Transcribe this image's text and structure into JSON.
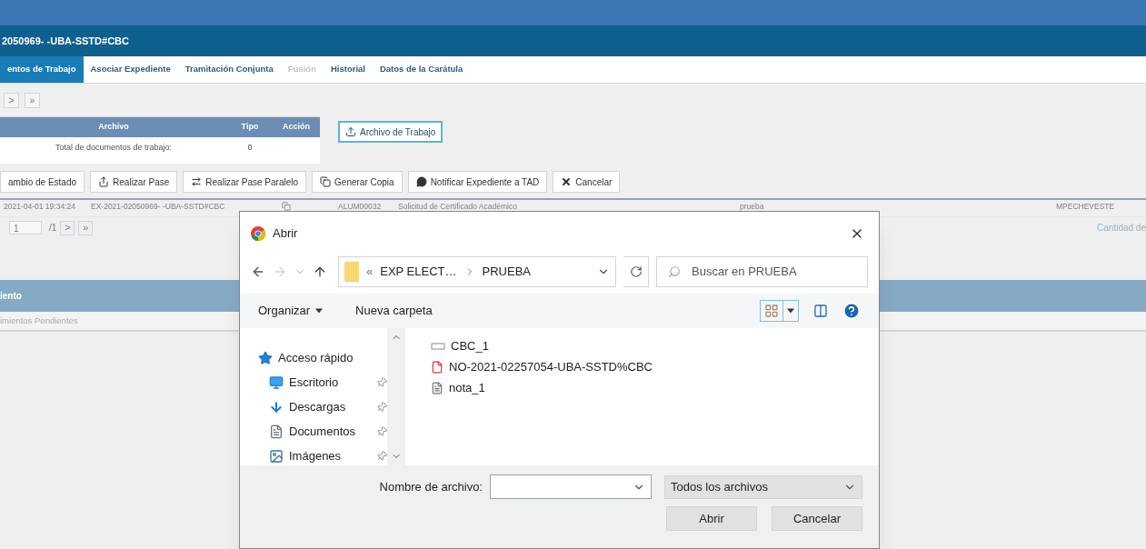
{
  "header": {
    "title": "2050969- -UBA-SSTD#CBC"
  },
  "tabs": [
    {
      "label": "entos de Trabajo",
      "selected": true,
      "disabled": false
    },
    {
      "label": "Asociar Expediente",
      "selected": false,
      "disabled": false
    },
    {
      "label": "Tramitación Conjunta",
      "selected": false,
      "disabled": false
    },
    {
      "label": "Fusión",
      "selected": false,
      "disabled": true
    },
    {
      "label": "Historial",
      "selected": false,
      "disabled": false
    },
    {
      "label": "Datos de la Carátula",
      "selected": false,
      "disabled": false
    }
  ],
  "pager_top": [
    ">",
    "»"
  ],
  "work_table": {
    "columns": [
      "Archivo",
      "Tipo",
      "Acción"
    ],
    "total_label": "Total de documentos de trabajo:",
    "total_value": "0"
  },
  "upload_button": "Archivo de Trabajo",
  "actions": [
    {
      "label": "ambio de Estado",
      "kind": "none"
    },
    {
      "label": "Realizar Pase",
      "kind": "share"
    },
    {
      "label": "Realizar Pase Paralelo",
      "kind": "swap"
    },
    {
      "label": "Generar Copia",
      "kind": "copy"
    },
    {
      "label": "Notificar Expediente a TAD",
      "kind": "comment"
    },
    {
      "label": "Cancelar",
      "kind": "cancel"
    }
  ],
  "record": {
    "date": "2021-04-01 19:34:24",
    "number": "EX-2021-02050969- -UBA-SSTD#CBC",
    "code": "ALUM00032",
    "subject": "Solicitud de Certificado Académico",
    "reason": "prueba",
    "user": "MPECHEVESTE"
  },
  "pager_bottom": {
    "page": "1",
    "total": "/1",
    "buttons": [
      ">",
      "»"
    ],
    "count_label": "Cantidad de"
  },
  "section": {
    "title": "iento",
    "subtitle": "imientos Pendientes"
  },
  "dialog": {
    "title": "Abrir",
    "breadcrumb": {
      "overflow": "«",
      "segments": [
        "EXP ELECT…",
        "PRUEBA"
      ]
    },
    "search": {
      "placeholder": "Buscar en PRUEBA"
    },
    "toolbar": [
      "Organizar",
      "Nueva carpeta"
    ],
    "nav": [
      {
        "label": "Acceso rápido",
        "kind": "star",
        "pinned": false
      },
      {
        "label": "Escritorio",
        "kind": "desktop",
        "pinned": true
      },
      {
        "label": "Descargas",
        "kind": "download",
        "pinned": true
      },
      {
        "label": "Documentos",
        "kind": "documents",
        "pinned": true
      },
      {
        "label": "Imágenes",
        "kind": "images",
        "pinned": true
      }
    ],
    "files": [
      {
        "name": "CBC_1",
        "kind": "generic"
      },
      {
        "name": "NO-2021-02257054-UBA-SSTD%CBC",
        "kind": "pdf"
      },
      {
        "name": "nota_1",
        "kind": "text"
      }
    ],
    "filename_label": "Nombre de archivo:",
    "filter": "Todos los archivos",
    "buttons": [
      "Abrir",
      "Cancelar"
    ]
  }
}
